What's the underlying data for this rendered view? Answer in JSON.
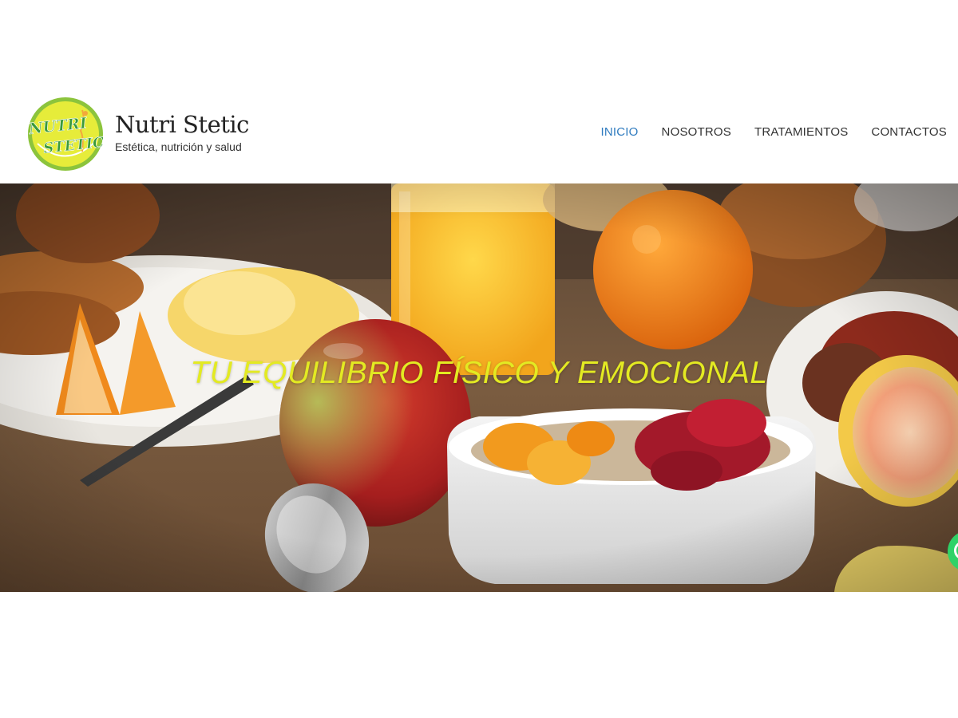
{
  "brand": {
    "title": "Nutri Stetic",
    "tagline": "Estética, nutrición y salud",
    "logo_text_line1": "NUTRI",
    "logo_text_line2": "STETIC"
  },
  "nav": {
    "items": [
      {
        "label": "INICIO",
        "active": true
      },
      {
        "label": "NOSOTROS",
        "active": false
      },
      {
        "label": "TRATAMIENTOS",
        "active": false
      },
      {
        "label": "CONTACTOS",
        "active": false
      }
    ]
  },
  "hero": {
    "title": "TU EQUILIBRIO FÍSICO Y EMOCIONAL",
    "image_icon": "breakfast-photo"
  },
  "floating": {
    "icon": "whatsapp-icon"
  },
  "colors": {
    "accent_nav": "#2f7bbf",
    "hero_title": "#e3ea22",
    "logo_green": "#8cc43c",
    "logo_yellow": "#e6ec3a",
    "whatsapp": "#2fd267"
  }
}
